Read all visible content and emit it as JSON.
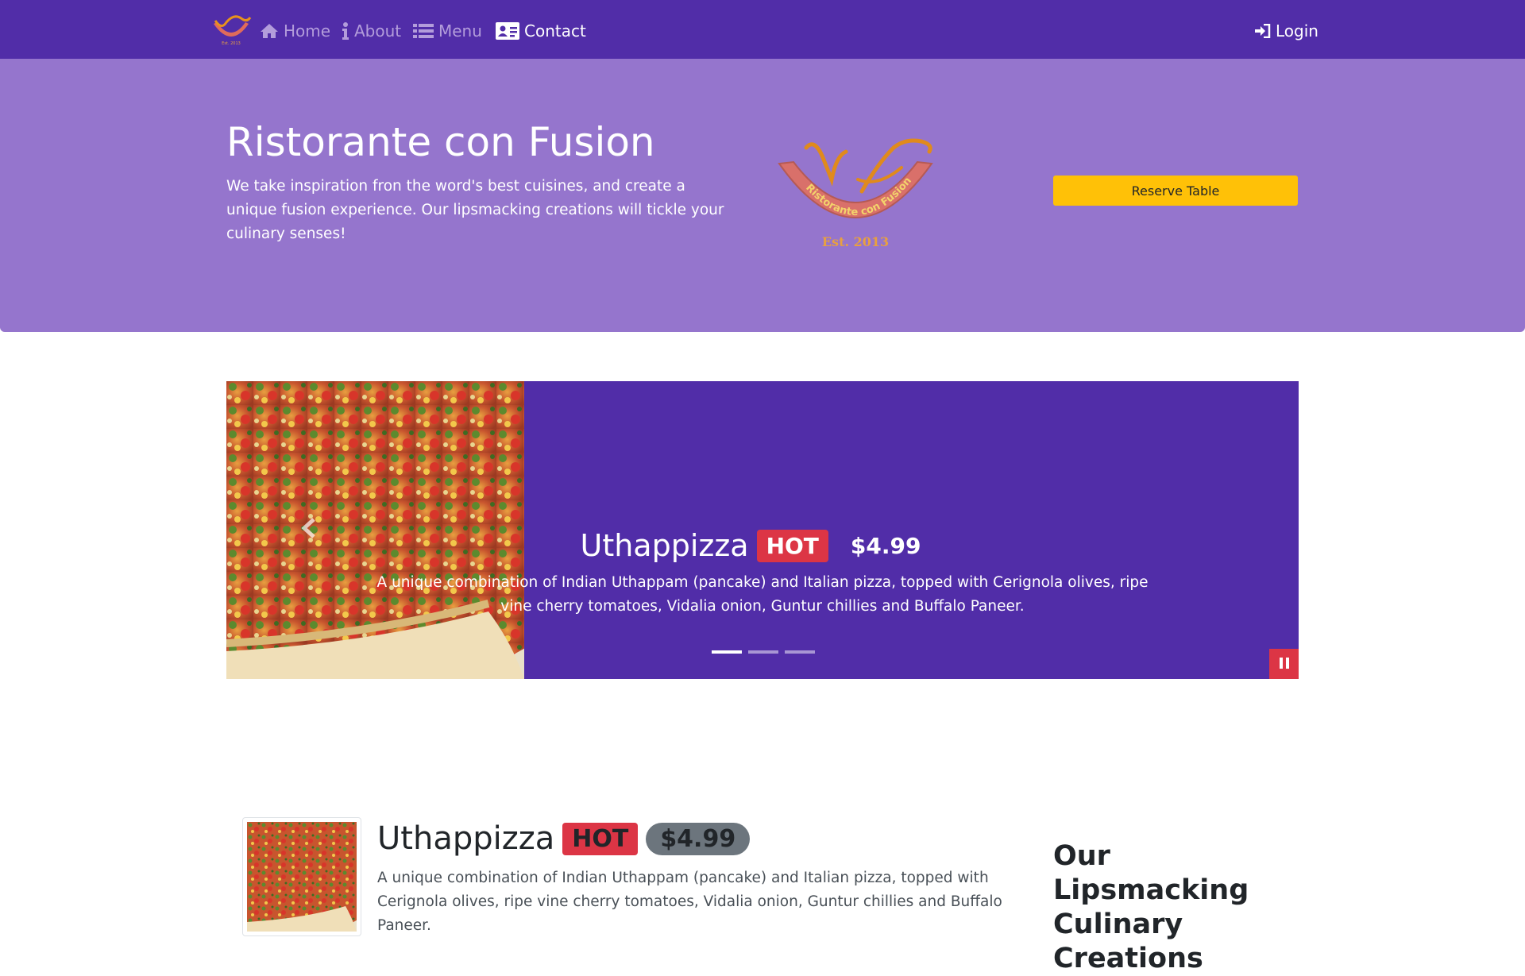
{
  "nav": {
    "brand_icon": "restaurant-logo",
    "items": [
      {
        "label": "Home",
        "icon": "home-icon",
        "active": false
      },
      {
        "label": "About",
        "icon": "info-icon",
        "active": false
      },
      {
        "label": "Menu",
        "icon": "list-icon",
        "active": false
      },
      {
        "label": "Contact",
        "icon": "address-card-icon",
        "active": true
      }
    ],
    "login_label": "Login",
    "login_icon": "sign-in-icon"
  },
  "jumbotron": {
    "title": "Ristorante con Fusion",
    "text": "We take inspiration fron the word's best cuisines, and create a unique fusion experience. Our lipsmacking creations will tickle your culinary senses!",
    "logo_text": "Ristorante con Fusion",
    "logo_est": "Est. 2013",
    "reserve_label": "Reserve Table"
  },
  "carousel": {
    "title": "Uthappizza",
    "badge": "HOT",
    "price": "$4.99",
    "description": "A unique combination of Indian Uthappam (pancake) and Italian pizza, topped with Cerignola olives, ripe vine cherry tomatoes, Vidalia onion, Guntur chillies and Buffalo Paneer.",
    "indicators": 3,
    "active_indicator": 0,
    "pause_icon": "pause-icon",
    "prev_icon": "chevron-left-icon"
  },
  "dish": {
    "title": "Uthappizza",
    "badge": "HOT",
    "price": "$4.99",
    "description": "A unique combination of Indian Uthappam (pancake) and Italian pizza, topped with Cerignola olives, ripe vine cherry tomatoes, Vidalia onion, Guntur chillies and Buffalo Paneer."
  },
  "section_heading": "Our Lipsmacking Culinary Creations",
  "colors": {
    "primary_dark": "#512da8",
    "primary_light": "#9575cd",
    "nav_inactive": "#b39ddb",
    "warning": "#ffc107",
    "danger": "#dc3545",
    "secondary": "#6c757d"
  }
}
